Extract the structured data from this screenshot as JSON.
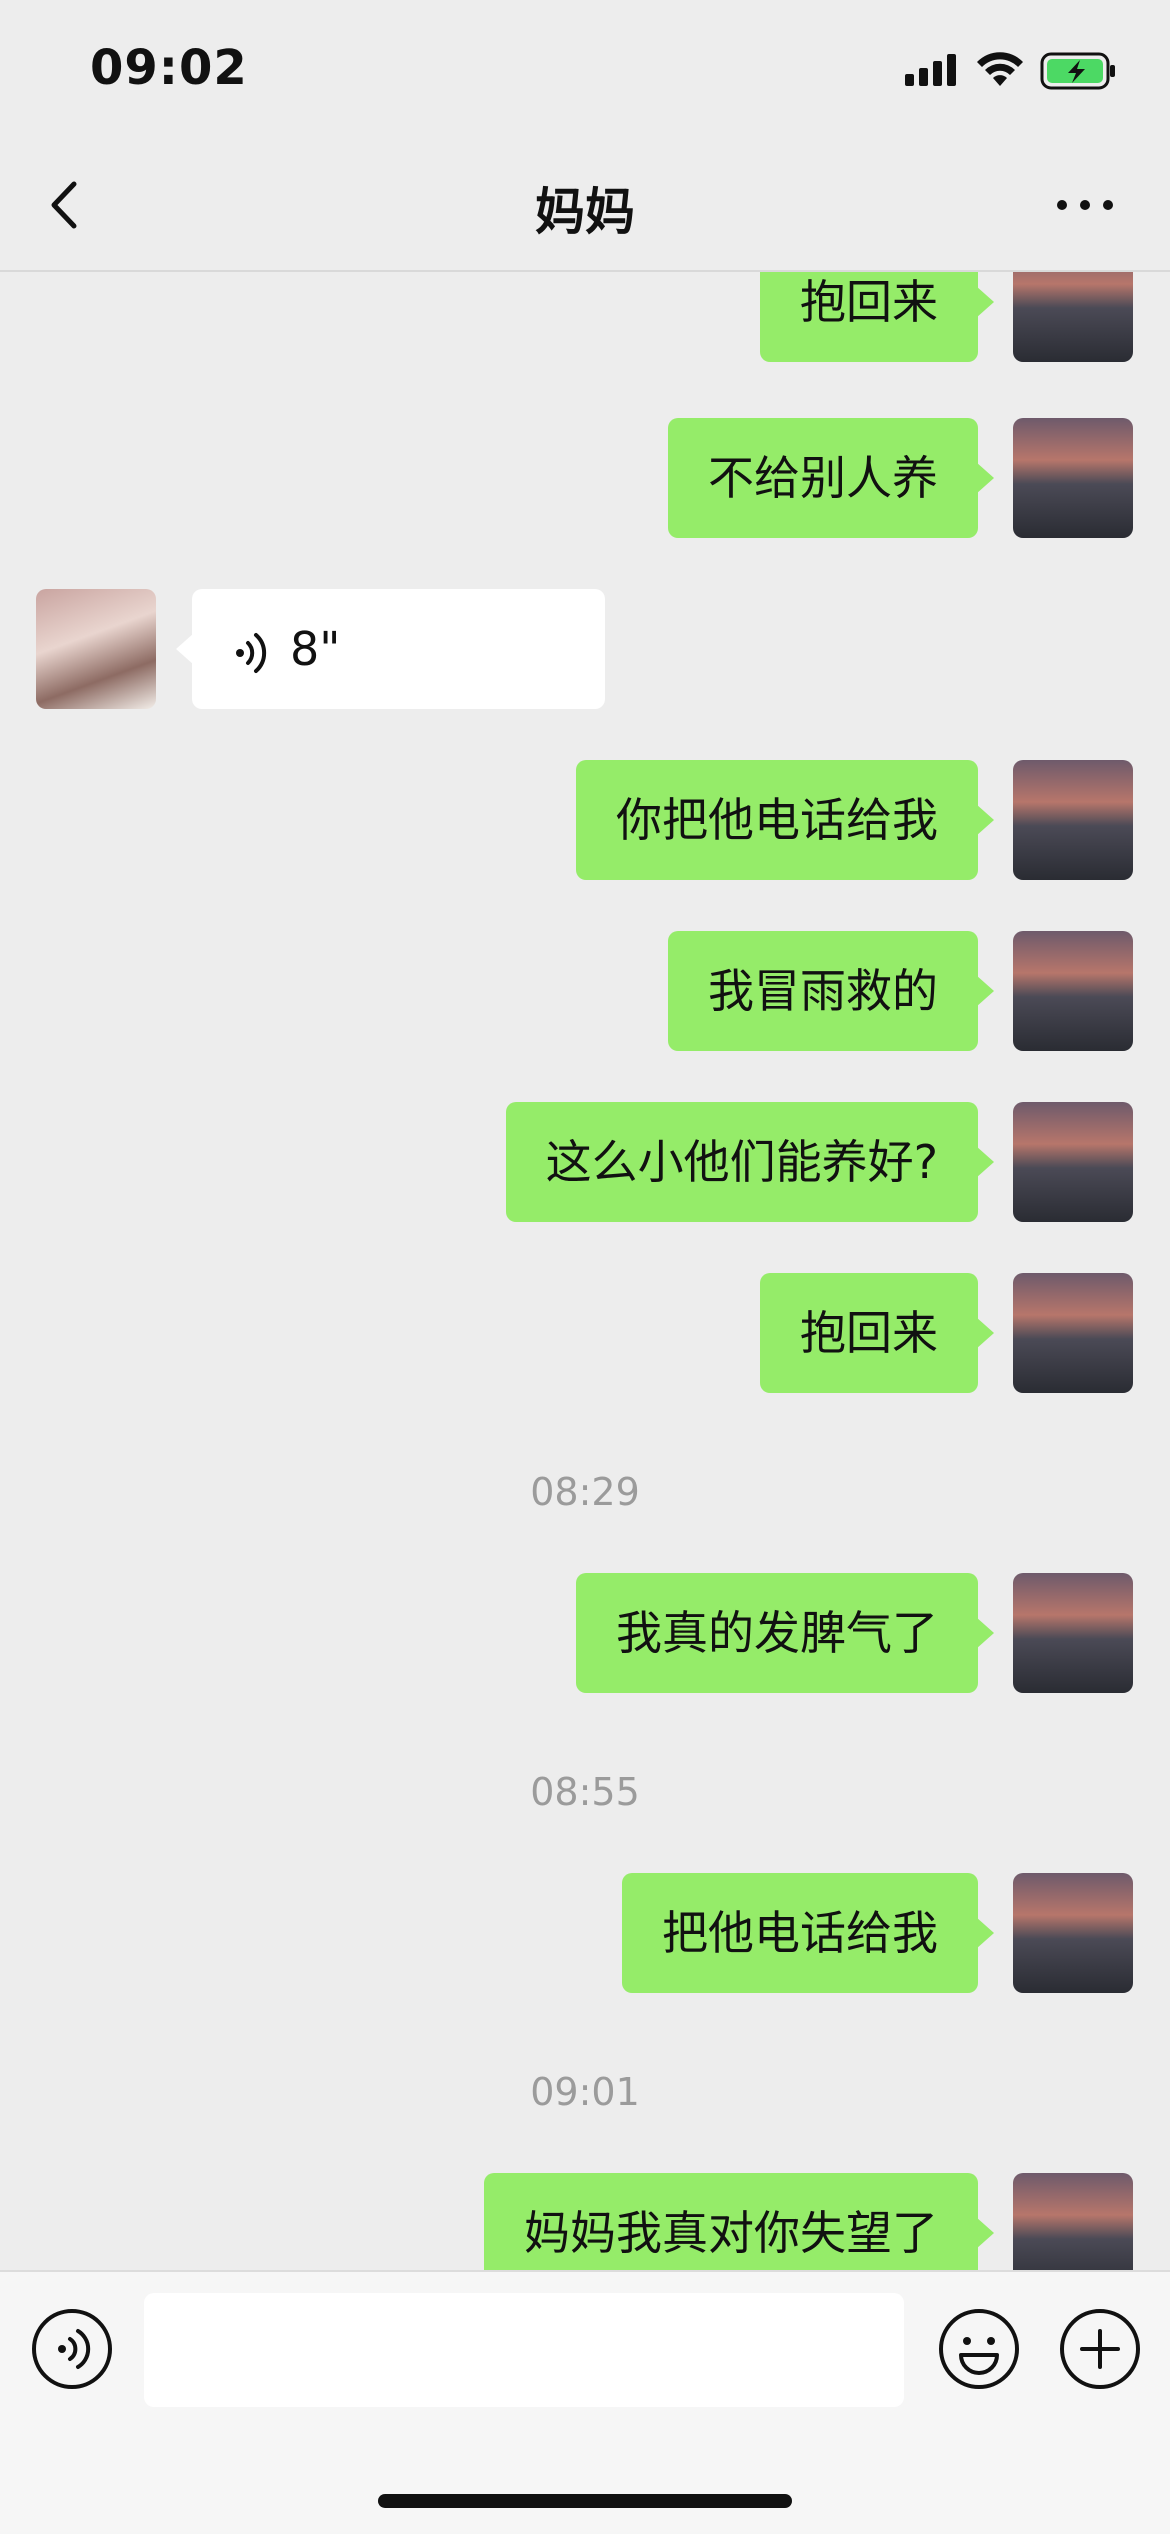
{
  "status": {
    "time": "09:02"
  },
  "nav": {
    "title": "妈妈"
  },
  "messages": [
    {
      "from": "me",
      "text": "抱回来"
    },
    {
      "from": "me",
      "text": "不给别人养"
    },
    {
      "from": "mom",
      "type": "voice",
      "duration": "8\""
    },
    {
      "from": "me",
      "text": "你把他电话给我"
    },
    {
      "from": "me",
      "text": "我冒雨救的"
    },
    {
      "from": "me",
      "text": "这么小他们能养好?"
    },
    {
      "from": "me",
      "text": "抱回来"
    },
    {
      "time": "08:29"
    },
    {
      "from": "me",
      "text": "我真的发脾气了"
    },
    {
      "time": "08:55"
    },
    {
      "from": "me",
      "text": "把他电话给我"
    },
    {
      "time": "09:01"
    },
    {
      "from": "me",
      "text": "妈妈我真对你失望了"
    }
  ],
  "input": {
    "value": "",
    "placeholder": ""
  },
  "icons": {
    "back": "chevron-left-icon",
    "more": "more-dots-icon",
    "voice": "voice-icon",
    "emoji": "emoji-icon",
    "plus": "plus-icon"
  },
  "colors": {
    "background": "#ededed",
    "my_bubble": "#95ec69",
    "their_bubble": "#ffffff",
    "timestamp": "#9b9b9b"
  }
}
